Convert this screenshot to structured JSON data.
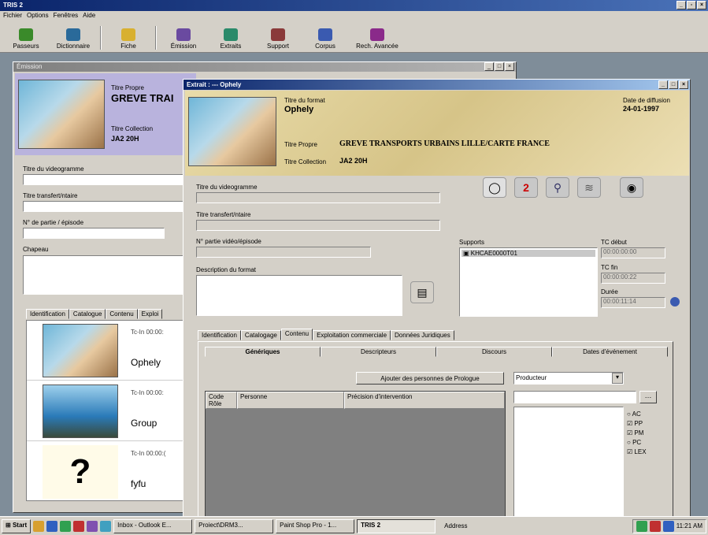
{
  "app": {
    "title": "TRIS 2",
    "menu": [
      "Fichier",
      "Options",
      "Fenêtres",
      "Aide"
    ]
  },
  "toolbar": [
    {
      "label": "Passeurs",
      "icon": "tree-icon",
      "color": "#3a8a2a"
    },
    {
      "label": "Dictionnaire",
      "icon": "book-icon",
      "color": "#2a6a9a"
    },
    {
      "label": "Fiche",
      "icon": "folder-icon",
      "color": "#d8b030"
    },
    {
      "label": "Émission",
      "icon": "broadcast-icon",
      "color": "#6a4aa0"
    },
    {
      "label": "Extraits",
      "icon": "extract-icon",
      "color": "#2a8a6a"
    },
    {
      "label": "Support",
      "icon": "support-icon",
      "color": "#8a3a3a"
    },
    {
      "label": "Corpus",
      "icon": "corpus-icon",
      "color": "#3a5ab0"
    },
    {
      "label": "Rech. Avancée",
      "icon": "advanced-search-icon",
      "color": "#8a2a8a"
    }
  ],
  "back_window": {
    "title": "Émission",
    "header": {
      "title_label": "Titre Propre",
      "title_value": "GREVE TRAI",
      "collection_label": "Titre Collection",
      "collection_value": "JA2 20H"
    },
    "fields": [
      {
        "label": "Titre du videogramme"
      },
      {
        "label": "Titre transfert/ntaire"
      },
      {
        "label": "N° de partie / épisode"
      },
      {
        "label": "Chapeau"
      }
    ],
    "tabs": [
      "Identification",
      "Catalogue",
      "Contenu",
      "Exploi"
    ],
    "list": [
      {
        "tc": "Tc-In   00:00:",
        "name": "Ophely"
      },
      {
        "tc": "Tc-In   00:00:",
        "name": "Group"
      },
      {
        "tc": "Tc-In   00:00:(",
        "name": "fyfu"
      }
    ]
  },
  "front_window": {
    "title": "Extrait : --- Ophely",
    "header": {
      "format_title_label": "Titre du format",
      "format_title_value": "Ophely",
      "title_label": "Titre Propre",
      "title_value": "GREVE TRANSPORTS URBAINS LILLE/CARTE FRANCE",
      "collection_label": "Titre Collection",
      "collection_value": "JA2 20H",
      "broadcast_date_label": "Date de diffusion",
      "broadcast_date_value": "24-01-1997"
    },
    "fields": [
      {
        "label": "Titre du videogramme"
      },
      {
        "label": "Titre transfert/ntaire"
      },
      {
        "label": "N° partie vidéo/épisode"
      },
      {
        "label": "Description du format"
      }
    ],
    "supports": {
      "label": "Supports",
      "items": [
        "KHCAE0000T01"
      ]
    },
    "timecodes": [
      {
        "label": "TC début",
        "value": "00:00:00:00"
      },
      {
        "label": "TC fin",
        "value": "00:00:00:22"
      },
      {
        "label": "Durée",
        "value": "00:00:11:14"
      }
    ],
    "tabs": [
      "Identification",
      "Catalogage",
      "Contenu",
      "Exploitation commerciale",
      "Données Juridiques"
    ],
    "subtabs": [
      "Génériques",
      "Descripteurs",
      "Discours",
      "Dates d'événement"
    ],
    "add_button": "Ajouter des personnes de Prologue",
    "role_select": "Producteur",
    "columns": [
      "Code Rôle",
      "Personne",
      "Précision d'intervention"
    ],
    "checks": [
      {
        "label": "AC",
        "checked": false
      },
      {
        "label": "PP",
        "checked": true
      },
      {
        "label": "PM",
        "checked": true
      },
      {
        "label": "PC",
        "checked": false
      },
      {
        "label": "LEX",
        "checked": true
      }
    ]
  },
  "taskbar": {
    "start": "Start",
    "tasks": [
      "Inbox - Outlook E...",
      "Proiect\\DRM3...",
      "Paint Shop Pro - 1...",
      "TRIS 2"
    ],
    "address": "Address",
    "clock": "11:21 AM"
  }
}
